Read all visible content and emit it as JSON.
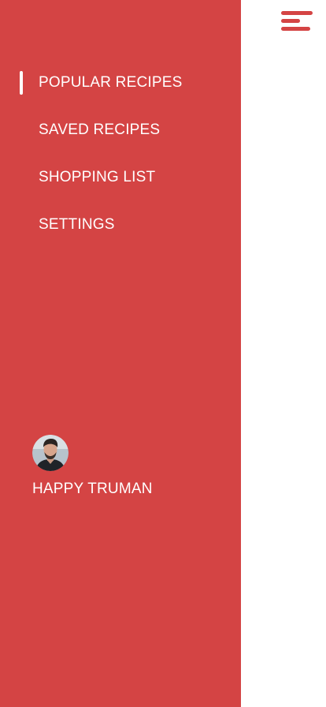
{
  "drawer": {
    "items": [
      {
        "label": "POPULAR RECIPES",
        "active": true
      },
      {
        "label": "SAVED RECIPES",
        "active": false
      },
      {
        "label": "SHOPPING LIST",
        "active": false
      },
      {
        "label": "SETTINGS",
        "active": false
      }
    ],
    "user": {
      "name": "HAPPY TRUMAN"
    }
  },
  "header": {
    "menu_icon": "hamburger-menu-icon"
  },
  "colors": {
    "accent": "#d44444",
    "drawer_text": "#ffffff",
    "content_bg": "#ffffff"
  }
}
